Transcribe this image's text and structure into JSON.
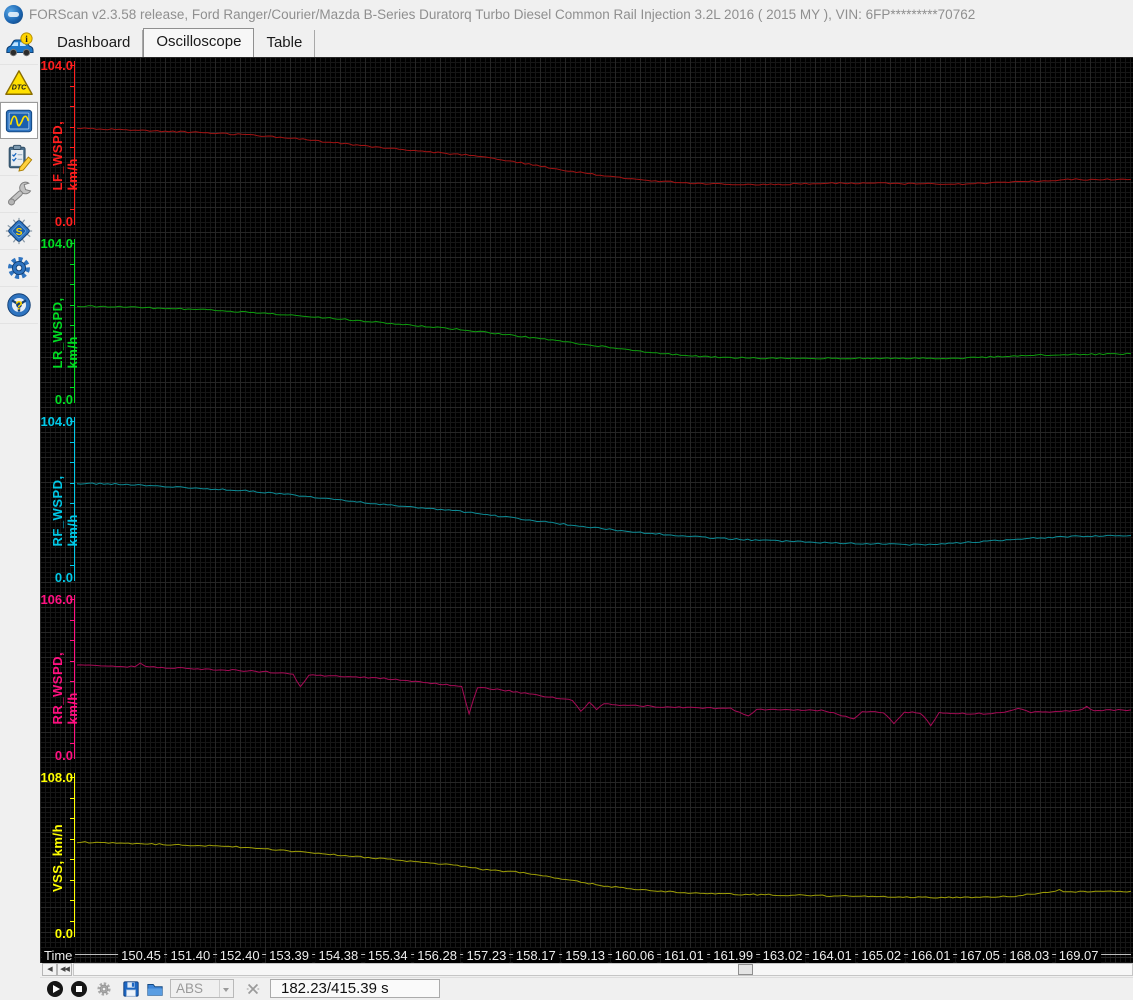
{
  "window": {
    "title": "FORScan v2.3.58 release, Ford Ranger/Courier/Mazda B-Series Duratorq Turbo Diesel Common Rail Injection 3.2L 2016 ( 2015 MY ), VIN: 6FP*********70762"
  },
  "tabs": [
    {
      "label": "Dashboard",
      "active": false
    },
    {
      "label": "Oscilloscope",
      "active": true
    },
    {
      "label": "Table",
      "active": false
    }
  ],
  "sidebar": {
    "items": [
      {
        "name": "vehicle-info",
        "icon": "car-info-icon",
        "badge": "i"
      },
      {
        "name": "dtc",
        "icon": "dtc-warning-icon",
        "badge": "DTC"
      },
      {
        "name": "oscilloscope",
        "icon": "oscilloscope-icon",
        "active": true
      },
      {
        "name": "tests",
        "icon": "clipboard-tests-icon"
      },
      {
        "name": "service",
        "icon": "wrench-icon"
      },
      {
        "name": "configuration",
        "icon": "chip-icon",
        "badge": "S"
      },
      {
        "name": "settings",
        "icon": "gear-icon"
      },
      {
        "name": "help",
        "icon": "steering-wheel-question-icon",
        "badge": "?"
      }
    ]
  },
  "oscilloscope": {
    "time_axis_label": "Time",
    "time_ticks": [
      "150.45",
      "151.40",
      "152.40",
      "153.39",
      "154.38",
      "155.34",
      "156.28",
      "157.23",
      "158.17",
      "159.13",
      "160.06",
      "161.01",
      "161.99",
      "163.02",
      "164.01",
      "165.02",
      "166.01",
      "167.05",
      "168.03",
      "169.07"
    ],
    "channels": [
      {
        "name": "LF_WSPD, km/h",
        "scale_max": "104.0",
        "scale_min": "0.0",
        "max": 104,
        "label_color": "#ff1e1e",
        "trace_color": "#a01212",
        "points": [
          [
            0,
            63
          ],
          [
            0.04,
            62
          ],
          [
            0.08,
            61
          ],
          [
            0.12,
            60
          ],
          [
            0.16,
            58.5
          ],
          [
            0.2,
            56.5
          ],
          [
            0.24,
            53.5
          ],
          [
            0.28,
            50.5
          ],
          [
            0.32,
            48
          ],
          [
            0.35,
            46
          ],
          [
            0.38,
            44.5
          ],
          [
            0.41,
            41
          ],
          [
            0.44,
            37.5
          ],
          [
            0.47,
            34
          ],
          [
            0.5,
            31
          ],
          [
            0.53,
            28.5
          ],
          [
            0.56,
            27
          ],
          [
            0.6,
            25.5
          ],
          [
            0.64,
            25
          ],
          [
            0.68,
            25.5
          ],
          [
            0.72,
            26
          ],
          [
            0.76,
            26
          ],
          [
            0.8,
            25.5
          ],
          [
            0.84,
            25.5
          ],
          [
            0.88,
            26.5
          ],
          [
            0.91,
            27.5
          ],
          [
            0.94,
            28.5
          ],
          [
            1,
            28.5
          ]
        ]
      },
      {
        "name": "LR_WSPD, km/h",
        "scale_max": "104.0",
        "scale_min": "0.0",
        "max": 104,
        "label_color": "#00dd22",
        "trace_color": "#0d9b0d",
        "points": [
          [
            0,
            63
          ],
          [
            0.04,
            62.5
          ],
          [
            0.08,
            61.5
          ],
          [
            0.12,
            60.5
          ],
          [
            0.16,
            59
          ],
          [
            0.2,
            57
          ],
          [
            0.24,
            55
          ],
          [
            0.28,
            52.5
          ],
          [
            0.32,
            50
          ],
          [
            0.36,
            47.5
          ],
          [
            0.4,
            44.5
          ],
          [
            0.44,
            41
          ],
          [
            0.48,
            37.5
          ],
          [
            0.52,
            34
          ],
          [
            0.55,
            31.5
          ],
          [
            0.58,
            29.5
          ],
          [
            0.62,
            28.5
          ],
          [
            0.66,
            28
          ],
          [
            0.72,
            28
          ],
          [
            0.78,
            28
          ],
          [
            0.84,
            28
          ],
          [
            0.87,
            29
          ],
          [
            0.9,
            30
          ],
          [
            0.94,
            30.5
          ],
          [
            1,
            31
          ]
        ]
      },
      {
        "name": "RF_WSPD, km/h",
        "scale_max": "104.0",
        "scale_min": "0.0",
        "max": 104,
        "label_color": "#00c8e6",
        "trace_color": "#0c8a94",
        "points": [
          [
            0,
            63.5
          ],
          [
            0.04,
            63
          ],
          [
            0.08,
            61.5
          ],
          [
            0.12,
            60
          ],
          [
            0.16,
            58.5
          ],
          [
            0.2,
            56
          ],
          [
            0.24,
            53
          ],
          [
            0.28,
            50
          ],
          [
            0.32,
            47.5
          ],
          [
            0.36,
            45
          ],
          [
            0.4,
            41.5
          ],
          [
            0.44,
            38
          ],
          [
            0.48,
            34.5
          ],
          [
            0.52,
            31.5
          ],
          [
            0.56,
            29
          ],
          [
            0.6,
            27
          ],
          [
            0.64,
            25.5
          ],
          [
            0.68,
            24.5
          ],
          [
            0.72,
            23.5
          ],
          [
            0.76,
            22.8
          ],
          [
            0.79,
            22.3
          ],
          [
            0.82,
            22.8
          ],
          [
            0.86,
            24.5
          ],
          [
            0.9,
            26.5
          ],
          [
            0.94,
            27.8
          ],
          [
            1,
            28.5
          ]
        ]
      },
      {
        "name": "RR_WSPD, km/h",
        "scale_max": "106.0",
        "scale_min": "0.0",
        "max": 106,
        "label_color": "#ff1080",
        "trace_color": "#a50a55",
        "points": [
          [
            0,
            62
          ],
          [
            0.03,
            61.5
          ],
          [
            0.055,
            61
          ],
          [
            0.06,
            63.5
          ],
          [
            0.065,
            61
          ],
          [
            0.1,
            60
          ],
          [
            0.14,
            59
          ],
          [
            0.18,
            57.5
          ],
          [
            0.205,
            56
          ],
          [
            0.212,
            47
          ],
          [
            0.22,
            55.5
          ],
          [
            0.25,
            54.5
          ],
          [
            0.28,
            53.5
          ],
          [
            0.31,
            52
          ],
          [
            0.34,
            49.5
          ],
          [
            0.365,
            47.5
          ],
          [
            0.372,
            29
          ],
          [
            0.38,
            47
          ],
          [
            0.41,
            44.5
          ],
          [
            0.44,
            41
          ],
          [
            0.47,
            38
          ],
          [
            0.478,
            31
          ],
          [
            0.486,
            36.5
          ],
          [
            0.493,
            32
          ],
          [
            0.5,
            35.5
          ],
          [
            0.53,
            34.5
          ],
          [
            0.56,
            33.5
          ],
          [
            0.59,
            33
          ],
          [
            0.62,
            32.5
          ],
          [
            0.637,
            27
          ],
          [
            0.645,
            32
          ],
          [
            0.68,
            31.5
          ],
          [
            0.71,
            31
          ],
          [
            0.737,
            25
          ],
          [
            0.745,
            30.5
          ],
          [
            0.765,
            30
          ],
          [
            0.775,
            22
          ],
          [
            0.785,
            30
          ],
          [
            0.8,
            29.5
          ],
          [
            0.81,
            21
          ],
          [
            0.818,
            29.5
          ],
          [
            0.84,
            29
          ],
          [
            0.86,
            29
          ],
          [
            0.88,
            29.5
          ],
          [
            0.893,
            33
          ],
          [
            0.905,
            30
          ],
          [
            0.93,
            30.5
          ],
          [
            0.95,
            31
          ],
          [
            0.958,
            33.5
          ],
          [
            0.965,
            31
          ],
          [
            0.98,
            31.5
          ],
          [
            1,
            31.5
          ]
        ]
      },
      {
        "name": "VSS, km/h",
        "scale_max": "108.0",
        "scale_min": "0.0",
        "max": 108,
        "label_color": "#ffff00",
        "trace_color": "#9d9d06",
        "points": [
          [
            0,
            64
          ],
          [
            0.03,
            63.5
          ],
          [
            0.06,
            63
          ],
          [
            0.1,
            62
          ],
          [
            0.14,
            61
          ],
          [
            0.17,
            60
          ],
          [
            0.2,
            58
          ],
          [
            0.24,
            55.5
          ],
          [
            0.28,
            53
          ],
          [
            0.32,
            50.5
          ],
          [
            0.35,
            48.5
          ],
          [
            0.375,
            46.5
          ],
          [
            0.385,
            45
          ],
          [
            0.42,
            43
          ],
          [
            0.46,
            38.5
          ],
          [
            0.5,
            33.5
          ],
          [
            0.54,
            30.5
          ],
          [
            0.58,
            28.5
          ],
          [
            0.62,
            27.8
          ],
          [
            0.66,
            27.3
          ],
          [
            0.7,
            26.8
          ],
          [
            0.74,
            26.3
          ],
          [
            0.78,
            25.7
          ],
          [
            0.82,
            25.5
          ],
          [
            0.86,
            25.5
          ],
          [
            0.89,
            26.5
          ],
          [
            0.905,
            28
          ],
          [
            0.925,
            29
          ],
          [
            0.932,
            30.5
          ],
          [
            0.94,
            29.3
          ],
          [
            0.97,
            29.5
          ],
          [
            1,
            29.8
          ]
        ]
      }
    ]
  },
  "scrollbar": {
    "left_arrow": "◀",
    "left_arrow_double": "◀◀"
  },
  "toolbar": {
    "module_dropdown_value": "ABS",
    "status_time": "182.23/415.39 s"
  }
}
